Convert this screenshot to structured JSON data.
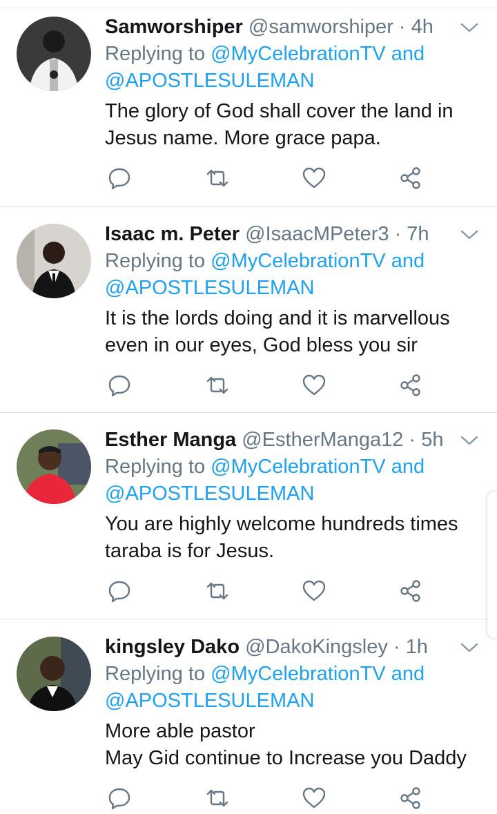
{
  "colors": {
    "accent": "#1da1f2",
    "secondary_text": "#657786",
    "primary_text": "#14171a"
  },
  "icons": [
    "chevron-down-icon",
    "reply-icon",
    "retweet-icon",
    "like-icon",
    "share-icon"
  ],
  "tweets": [
    {
      "name": "Samworshiper",
      "handle": "@samworshiper",
      "dot": "·",
      "time": "4h",
      "replying_prefix": "Replying to",
      "mention1": "@MyCelebrationTV",
      "and_word": "and",
      "mention2": "@APOSTLESULEMAN",
      "lines": [
        "The glory of God shall cover the land in",
        "Jesus name. More grace papa."
      ]
    },
    {
      "name": "Isaac m. Peter",
      "handle": "@IsaacMPeter3",
      "dot": "·",
      "time": "7h",
      "replying_prefix": "Replying to",
      "mention1": "@MyCelebrationTV",
      "and_word": "and",
      "mention2": "@APOSTLESULEMAN",
      "lines": [
        "It is the lords doing and it is marvellous",
        "even in our eyes, God bless you sir"
      ]
    },
    {
      "name": "Esther Manga",
      "handle": "@EstherManga12",
      "dot": "·",
      "time": "5h",
      "replying_prefix": "Replying to",
      "mention1": "@MyCelebrationTV",
      "and_word": "and",
      "mention2": "@APOSTLESULEMAN",
      "lines": [
        "You are highly welcome hundreds times",
        "taraba is for Jesus."
      ]
    },
    {
      "name": "kingsley Dako",
      "handle": "@DakoKingsley",
      "dot": "·",
      "time": "1h",
      "replying_prefix": "Replying to",
      "mention1": "@MyCelebrationTV",
      "and_word": "and",
      "mention2": "@APOSTLESULEMAN",
      "lines": [
        "More able pastor",
        "May Gid continue to Increase you Daddy"
      ]
    }
  ]
}
